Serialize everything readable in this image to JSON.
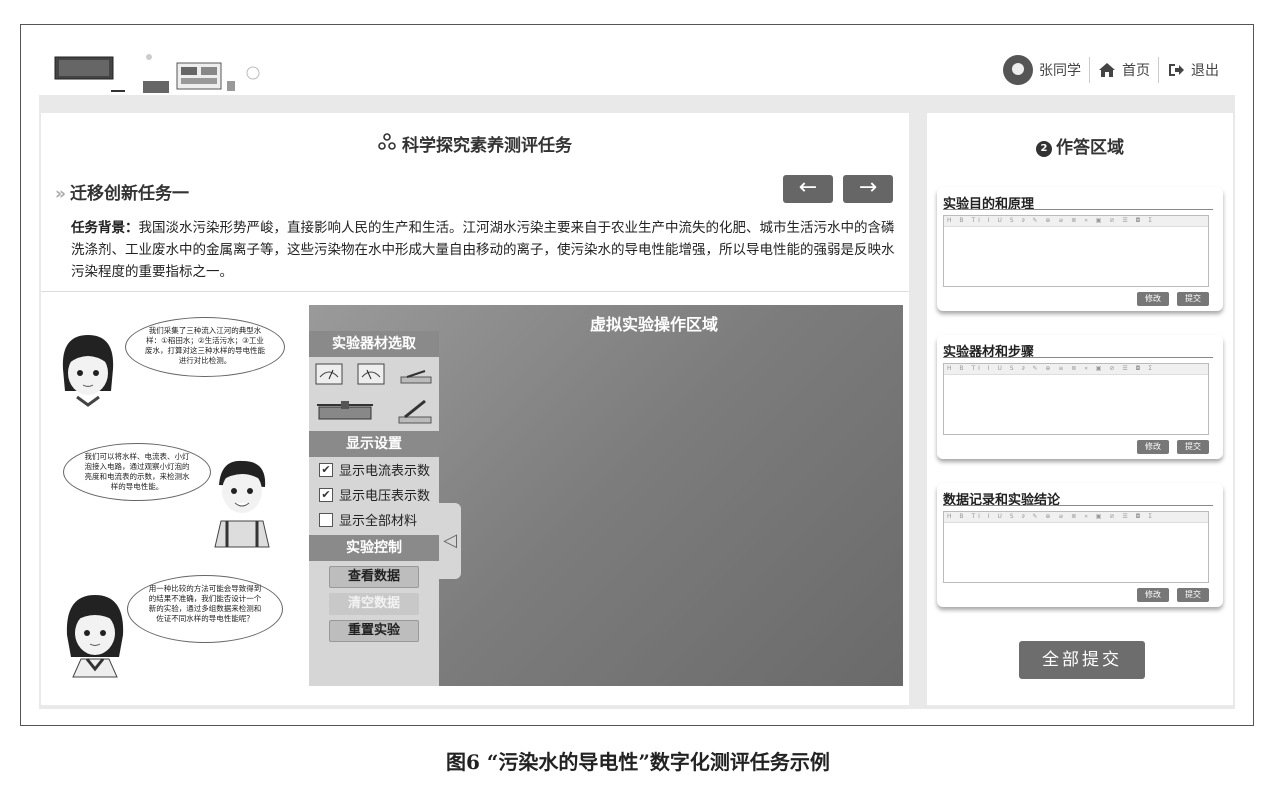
{
  "header": {
    "username": "张同学",
    "home_label": "首页",
    "logout_label": "退出"
  },
  "task": {
    "title": "科学探究素养测评任务",
    "subtitle": "迁移创新任务一",
    "background_label": "任务背景：",
    "background_text": "我国淡水污染形势严峻，直接影响人民的生产和生活。江河湖水污染主要来自于农业生产中流失的化肥、城市生活污水中的含磷洗涤剂、工业废水中的金属离子等，这些污染物在水中形成大量自由移动的离子，使污染水的导电性能增强，所以导电性能的强弱是反映水污染程度的重要指标之一。",
    "prev_symbol": "←",
    "next_symbol": "→"
  },
  "dialogs": [
    "我们采集了三种流入江河的典型水样：①稻田水；②生活污水；③工业废水，打算对这三种水样的导电性能进行对比检测。",
    "我们可以将水样、电流表、小灯泡接入电路，通过观察小灯泡的亮度和电流表的示数，来检测水样的导电性能。",
    "用一种比较的方法可能会导致得到的结果不准确，我们能否设计一个新的实验，通过多组数据来检测和佐证不同水样的导电性能呢？"
  ],
  "sim": {
    "title": "虚拟实验操作区域",
    "equipment_header": "实验器材选取",
    "display_header": "显示设置",
    "options": [
      {
        "label": "显示电流表示数",
        "checked": true
      },
      {
        "label": "显示电压表示数",
        "checked": true
      },
      {
        "label": "显示全部材料",
        "checked": false
      }
    ],
    "control_header": "实验控制",
    "buttons": [
      "查看数据",
      "清空数据",
      "重置实验"
    ],
    "collapse_symbol": "◁"
  },
  "answer": {
    "number": "2",
    "title": "作答区域",
    "sections": [
      {
        "title": "实验目的和原理",
        "edit": "修改",
        "submit": "提交"
      },
      {
        "title": "实验器材和步骤",
        "edit": "修改",
        "submit": "提交"
      },
      {
        "title": "数据记录和实验结论",
        "edit": "修改",
        "submit": "提交"
      }
    ],
    "submit_all": "全部提交"
  },
  "caption": "图6 “污染水的导电性”数字化测评任务示例"
}
